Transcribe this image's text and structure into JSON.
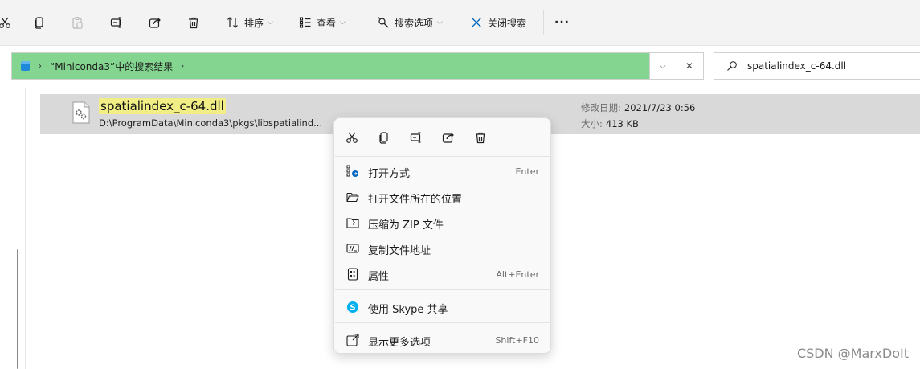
{
  "toolbar": {
    "sort_label": "排序",
    "view_label": "查看",
    "search_options_label": "搜索选项",
    "close_search_label": "关闭搜索",
    "more_label": "···"
  },
  "address": {
    "location": "“Miniconda3”中的搜索结果"
  },
  "search": {
    "query": "spatialindex_c-64.dll"
  },
  "result": {
    "name": "spatialindex_c-64.dll",
    "path": "D:\\ProgramData\\Miniconda3\\pkgs\\libspatialind...",
    "date_label": "修改日期:",
    "date_value": "2021/7/23 0:56",
    "size_label": "大小:",
    "size_value": "413 KB"
  },
  "context_menu": {
    "items": [
      {
        "label": "打开方式",
        "shortcut": "Enter"
      },
      {
        "label": "打开文件所在的位置",
        "shortcut": ""
      },
      {
        "label": "压缩为 ZIP 文件",
        "shortcut": ""
      },
      {
        "label": "复制文件地址",
        "shortcut": ""
      },
      {
        "label": "属性",
        "shortcut": "Alt+Enter"
      },
      {
        "label": "使用 Skype 共享",
        "shortcut": ""
      },
      {
        "label": "显示更多选项",
        "shortcut": "Shift+F10"
      }
    ]
  },
  "colors": {
    "accent": "#0067c0",
    "address_highlight": "#84d58f",
    "match_highlight": "#f2ee86",
    "skype": "#00aff0"
  },
  "watermark": "CSDN @MarxDoIt"
}
